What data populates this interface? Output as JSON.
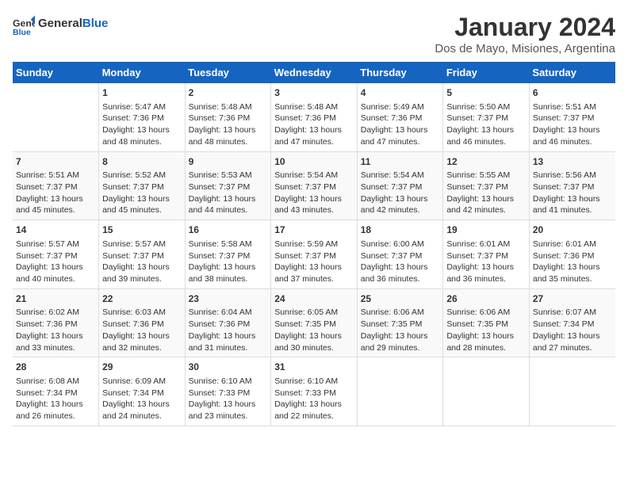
{
  "logo": {
    "general": "General",
    "blue": "Blue"
  },
  "title": "January 2024",
  "subtitle": "Dos de Mayo, Misiones, Argentina",
  "weekdays": [
    "Sunday",
    "Monday",
    "Tuesday",
    "Wednesday",
    "Thursday",
    "Friday",
    "Saturday"
  ],
  "weeks": [
    [
      {
        "day": "",
        "sunrise": "",
        "sunset": "",
        "daylight": ""
      },
      {
        "day": "1",
        "sunrise": "Sunrise: 5:47 AM",
        "sunset": "Sunset: 7:36 PM",
        "daylight": "Daylight: 13 hours and 48 minutes."
      },
      {
        "day": "2",
        "sunrise": "Sunrise: 5:48 AM",
        "sunset": "Sunset: 7:36 PM",
        "daylight": "Daylight: 13 hours and 48 minutes."
      },
      {
        "day": "3",
        "sunrise": "Sunrise: 5:48 AM",
        "sunset": "Sunset: 7:36 PM",
        "daylight": "Daylight: 13 hours and 47 minutes."
      },
      {
        "day": "4",
        "sunrise": "Sunrise: 5:49 AM",
        "sunset": "Sunset: 7:36 PM",
        "daylight": "Daylight: 13 hours and 47 minutes."
      },
      {
        "day": "5",
        "sunrise": "Sunrise: 5:50 AM",
        "sunset": "Sunset: 7:37 PM",
        "daylight": "Daylight: 13 hours and 46 minutes."
      },
      {
        "day": "6",
        "sunrise": "Sunrise: 5:51 AM",
        "sunset": "Sunset: 7:37 PM",
        "daylight": "Daylight: 13 hours and 46 minutes."
      }
    ],
    [
      {
        "day": "7",
        "sunrise": "Sunrise: 5:51 AM",
        "sunset": "Sunset: 7:37 PM",
        "daylight": "Daylight: 13 hours and 45 minutes."
      },
      {
        "day": "8",
        "sunrise": "Sunrise: 5:52 AM",
        "sunset": "Sunset: 7:37 PM",
        "daylight": "Daylight: 13 hours and 45 minutes."
      },
      {
        "day": "9",
        "sunrise": "Sunrise: 5:53 AM",
        "sunset": "Sunset: 7:37 PM",
        "daylight": "Daylight: 13 hours and 44 minutes."
      },
      {
        "day": "10",
        "sunrise": "Sunrise: 5:54 AM",
        "sunset": "Sunset: 7:37 PM",
        "daylight": "Daylight: 13 hours and 43 minutes."
      },
      {
        "day": "11",
        "sunrise": "Sunrise: 5:54 AM",
        "sunset": "Sunset: 7:37 PM",
        "daylight": "Daylight: 13 hours and 42 minutes."
      },
      {
        "day": "12",
        "sunrise": "Sunrise: 5:55 AM",
        "sunset": "Sunset: 7:37 PM",
        "daylight": "Daylight: 13 hours and 42 minutes."
      },
      {
        "day": "13",
        "sunrise": "Sunrise: 5:56 AM",
        "sunset": "Sunset: 7:37 PM",
        "daylight": "Daylight: 13 hours and 41 minutes."
      }
    ],
    [
      {
        "day": "14",
        "sunrise": "Sunrise: 5:57 AM",
        "sunset": "Sunset: 7:37 PM",
        "daylight": "Daylight: 13 hours and 40 minutes."
      },
      {
        "day": "15",
        "sunrise": "Sunrise: 5:57 AM",
        "sunset": "Sunset: 7:37 PM",
        "daylight": "Daylight: 13 hours and 39 minutes."
      },
      {
        "day": "16",
        "sunrise": "Sunrise: 5:58 AM",
        "sunset": "Sunset: 7:37 PM",
        "daylight": "Daylight: 13 hours and 38 minutes."
      },
      {
        "day": "17",
        "sunrise": "Sunrise: 5:59 AM",
        "sunset": "Sunset: 7:37 PM",
        "daylight": "Daylight: 13 hours and 37 minutes."
      },
      {
        "day": "18",
        "sunrise": "Sunrise: 6:00 AM",
        "sunset": "Sunset: 7:37 PM",
        "daylight": "Daylight: 13 hours and 36 minutes."
      },
      {
        "day": "19",
        "sunrise": "Sunrise: 6:01 AM",
        "sunset": "Sunset: 7:37 PM",
        "daylight": "Daylight: 13 hours and 36 minutes."
      },
      {
        "day": "20",
        "sunrise": "Sunrise: 6:01 AM",
        "sunset": "Sunset: 7:36 PM",
        "daylight": "Daylight: 13 hours and 35 minutes."
      }
    ],
    [
      {
        "day": "21",
        "sunrise": "Sunrise: 6:02 AM",
        "sunset": "Sunset: 7:36 PM",
        "daylight": "Daylight: 13 hours and 33 minutes."
      },
      {
        "day": "22",
        "sunrise": "Sunrise: 6:03 AM",
        "sunset": "Sunset: 7:36 PM",
        "daylight": "Daylight: 13 hours and 32 minutes."
      },
      {
        "day": "23",
        "sunrise": "Sunrise: 6:04 AM",
        "sunset": "Sunset: 7:36 PM",
        "daylight": "Daylight: 13 hours and 31 minutes."
      },
      {
        "day": "24",
        "sunrise": "Sunrise: 6:05 AM",
        "sunset": "Sunset: 7:35 PM",
        "daylight": "Daylight: 13 hours and 30 minutes."
      },
      {
        "day": "25",
        "sunrise": "Sunrise: 6:06 AM",
        "sunset": "Sunset: 7:35 PM",
        "daylight": "Daylight: 13 hours and 29 minutes."
      },
      {
        "day": "26",
        "sunrise": "Sunrise: 6:06 AM",
        "sunset": "Sunset: 7:35 PM",
        "daylight": "Daylight: 13 hours and 28 minutes."
      },
      {
        "day": "27",
        "sunrise": "Sunrise: 6:07 AM",
        "sunset": "Sunset: 7:34 PM",
        "daylight": "Daylight: 13 hours and 27 minutes."
      }
    ],
    [
      {
        "day": "28",
        "sunrise": "Sunrise: 6:08 AM",
        "sunset": "Sunset: 7:34 PM",
        "daylight": "Daylight: 13 hours and 26 minutes."
      },
      {
        "day": "29",
        "sunrise": "Sunrise: 6:09 AM",
        "sunset": "Sunset: 7:34 PM",
        "daylight": "Daylight: 13 hours and 24 minutes."
      },
      {
        "day": "30",
        "sunrise": "Sunrise: 6:10 AM",
        "sunset": "Sunset: 7:33 PM",
        "daylight": "Daylight: 13 hours and 23 minutes."
      },
      {
        "day": "31",
        "sunrise": "Sunrise: 6:10 AM",
        "sunset": "Sunset: 7:33 PM",
        "daylight": "Daylight: 13 hours and 22 minutes."
      },
      {
        "day": "",
        "sunrise": "",
        "sunset": "",
        "daylight": ""
      },
      {
        "day": "",
        "sunrise": "",
        "sunset": "",
        "daylight": ""
      },
      {
        "day": "",
        "sunrise": "",
        "sunset": "",
        "daylight": ""
      }
    ]
  ]
}
